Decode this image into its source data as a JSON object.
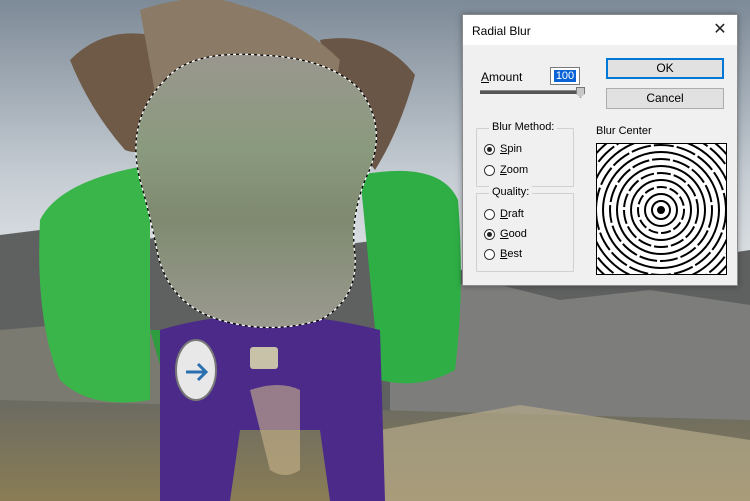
{
  "dialog": {
    "title": "Radial Blur",
    "close_icon": "close-icon",
    "amount": {
      "label_first": "A",
      "label_rest": "mount",
      "value": "100",
      "slider_fraction": 1.0
    },
    "ok_label": "OK",
    "cancel_label": "Cancel",
    "blur_method": {
      "label": "Blur Method:",
      "options": [
        {
          "first": "S",
          "rest": "pin",
          "checked": true
        },
        {
          "first": "Z",
          "rest": "oom",
          "checked": false
        }
      ]
    },
    "quality": {
      "label": "Quality:",
      "options": [
        {
          "first": "D",
          "rest": "raft",
          "checked": false
        },
        {
          "first": "G",
          "rest": "ood",
          "checked": true
        },
        {
          "first": "B",
          "rest": "est",
          "checked": false
        }
      ]
    },
    "blur_center_label": "Blur Center"
  }
}
